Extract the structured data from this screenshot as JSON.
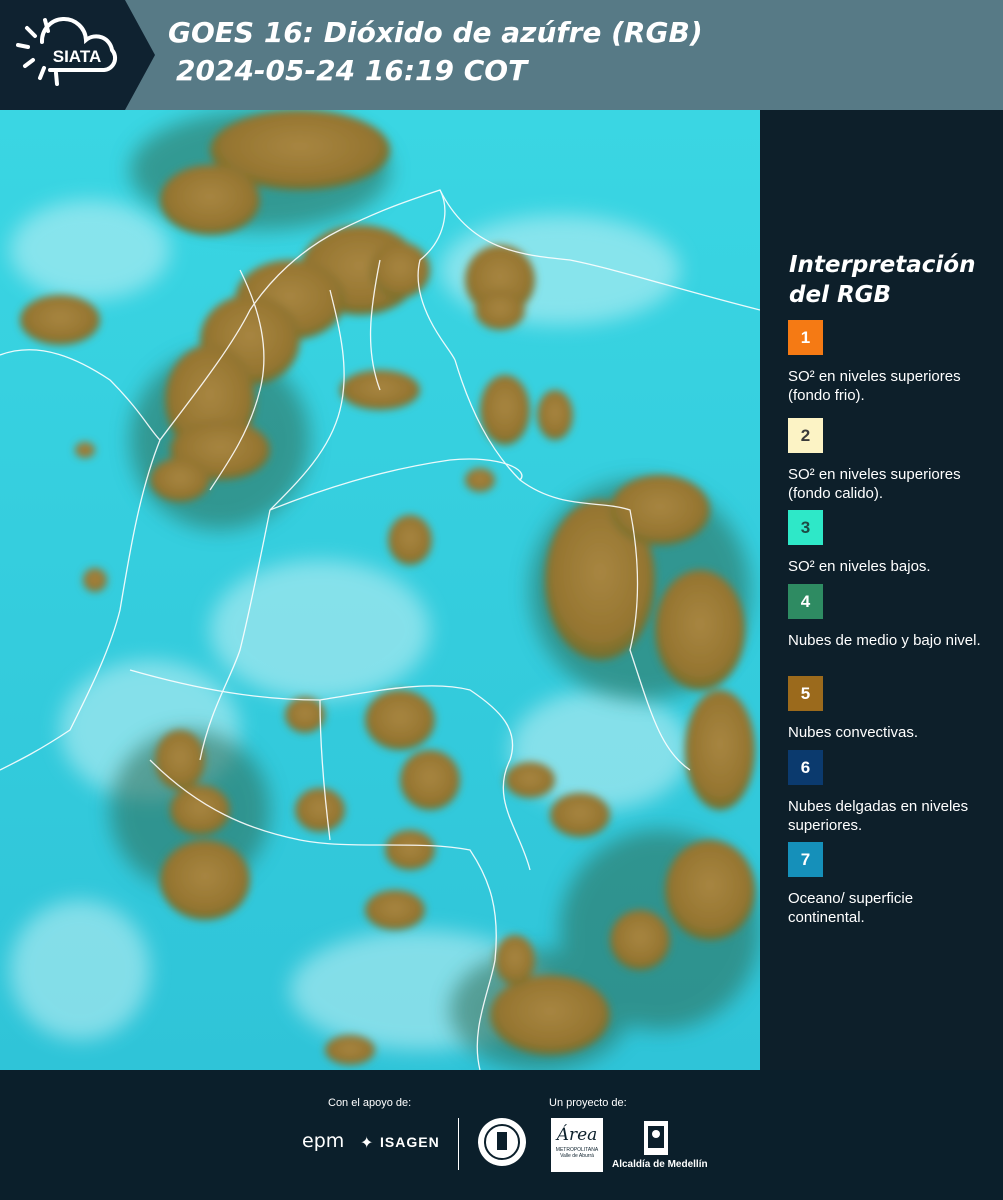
{
  "header": {
    "logo_text": "SIATA",
    "title_line1": "GOES 16: Dióxido de azúfre (RGB)",
    "title_line2": "2024-05-24 16:19 COT"
  },
  "legend": {
    "title_line1": "Interpretación",
    "title_line2": "del RGB",
    "items": [
      {
        "number": "1",
        "color": "#f57a14",
        "description": "SO² en niveles superiores (fondo frio)."
      },
      {
        "number": "2",
        "color": "#fcf3c5",
        "description": "SO² en niveles superiores (fondo calido)."
      },
      {
        "number": "3",
        "color": "#2ee8c8",
        "description": "SO² en niveles bajos."
      },
      {
        "number": "4",
        "color": "#2e8b62",
        "description": "Nubes de medio y bajo nivel."
      },
      {
        "number": "5",
        "color": "#9b6a1c",
        "description": "Nubes convectivas."
      },
      {
        "number": "6",
        "color": "#0b3a6e",
        "description": "Nubes delgadas en niveles superiores."
      },
      {
        "number": "7",
        "color": "#1590ba",
        "description": "Oceano/ superficie continental."
      }
    ]
  },
  "footer": {
    "support_label": "Con el apoyo de:",
    "project_label": "Un proyecto de:",
    "epm_logo": "epm",
    "isagen_logo": "ISAGEN",
    "area_logo_main": "Área",
    "area_logo_sub1": "METROPOLITANA",
    "area_logo_sub2": "Valle de Aburrá",
    "alcaldia_logo": "Alcaldía de Medellín"
  },
  "colors": {
    "header_bg": "#577a86",
    "logo_bg": "#0f2230",
    "background": "#0b1f2b",
    "map_cyan": "#30d0e0",
    "cloud_brown": "#9b7a35"
  }
}
